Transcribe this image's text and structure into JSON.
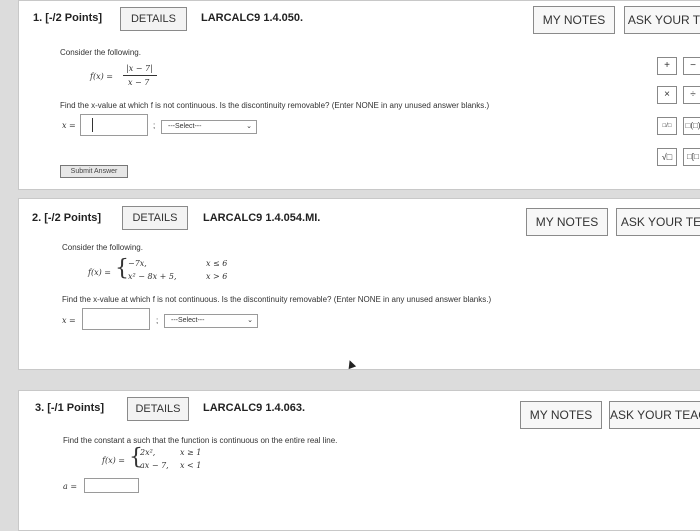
{
  "questions": [
    {
      "header": "1. [-/2 Points]",
      "details_label": "DETAILS",
      "code": "LARCALC9 1.4.050.",
      "my_notes_label": "MY NOTES",
      "ask_label": "ASK YOUR T",
      "intro": "Consider the following.",
      "function_lhs": "f(x) =",
      "numerator": "|x − 7|",
      "denominator": "x − 7",
      "prompt": "Find the x-value at which f is not continuous. Is the discontinuity removable? (Enter NONE in any unused answer blanks.)",
      "input_label": "x =",
      "select_value": "---Select---",
      "submit_label": "Submit Answer"
    },
    {
      "header": "2. [-/2 Points]",
      "details_label": "DETAILS",
      "code": "LARCALC9 1.4.054.MI.",
      "my_notes_label": "MY NOTES",
      "ask_label": "ASK YOUR TE",
      "intro": "Consider the following.",
      "function_lhs": "f(x) =",
      "piece1_expr": "−7x,",
      "piece1_cond": "x ≤ 6",
      "piece2_expr": "x² − 8x + 5,",
      "piece2_cond": "x > 6",
      "prompt": "Find the x-value at which f is not continuous. Is the discontinuity removable? (Enter NONE in any unused answer blanks.)",
      "input_label": "x =",
      "select_value": "---Select---"
    },
    {
      "header": "3. [-/1 Points]",
      "details_label": "DETAILS",
      "code": "LARCALC9 1.4.063.",
      "my_notes_label": "MY NOTES",
      "ask_label": "ASK YOUR TEAC",
      "prompt": "Find the constant a such that the function is continuous on the entire real line.",
      "function_lhs": "f(x) =",
      "piece1_expr": "2x²,",
      "piece1_cond": "x ≥ 1",
      "piece2_expr": "ax − 7,",
      "piece2_cond": "x < 1",
      "input_label": "a ="
    }
  ],
  "math_toolbar": {
    "plus": "+",
    "minus": "−",
    "times": "×",
    "divide": "÷",
    "fraction": "□/□",
    "paren": "□(□)",
    "sqrt": "√□",
    "brackets": "□[□"
  },
  "colors": {
    "background": "#dcdcdc",
    "panel": "#ffffff",
    "border": "#8a8a8a"
  }
}
